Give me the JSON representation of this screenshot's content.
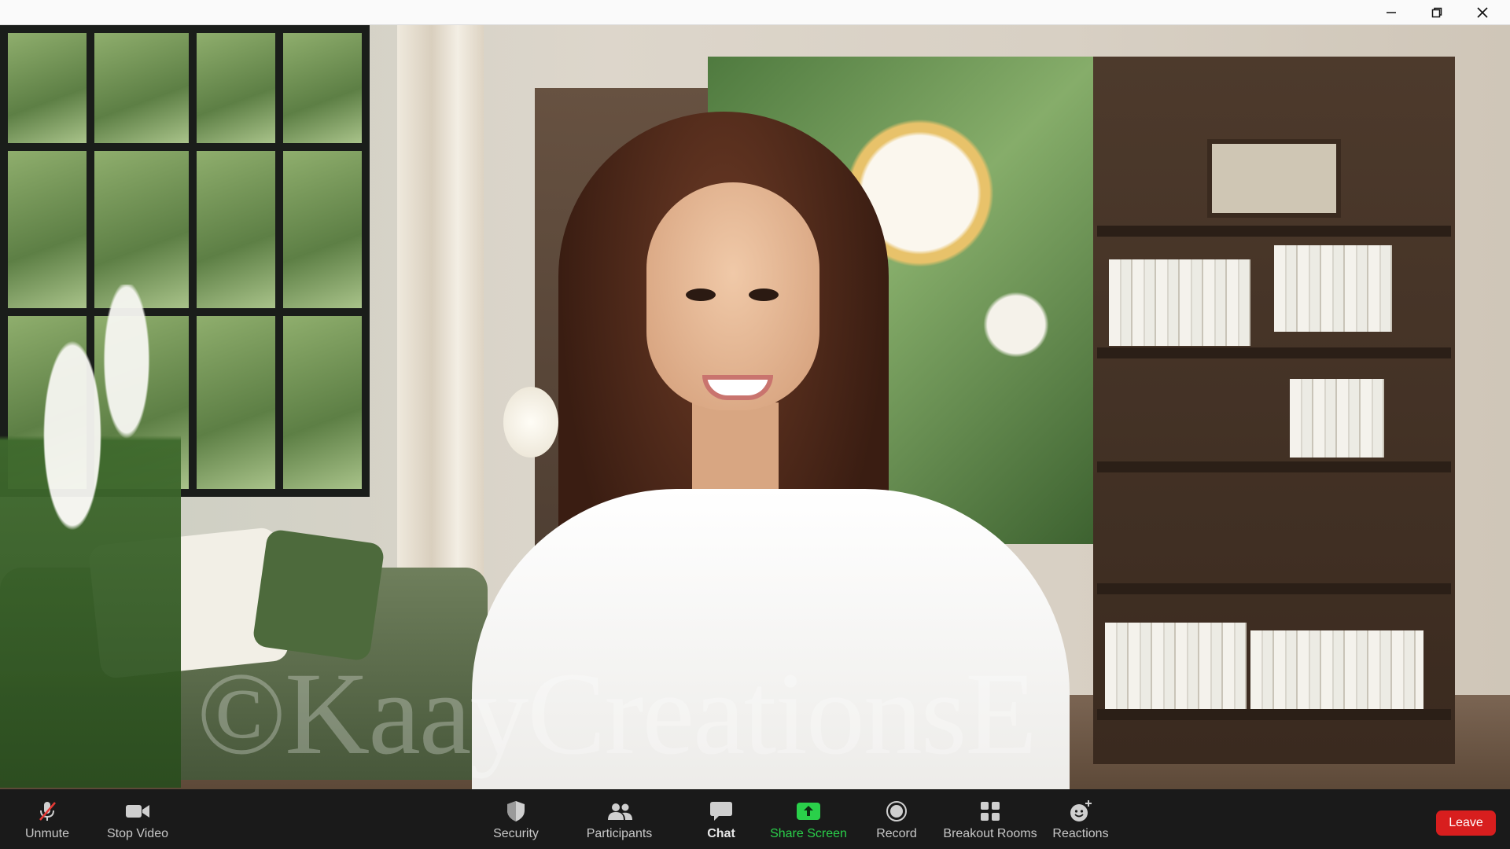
{
  "window": {
    "controls": {
      "minimize": "minimize",
      "maximize": "restore",
      "close": "close"
    }
  },
  "video": {
    "watermark": "©KaayCreationsE"
  },
  "toolbar": {
    "unmute": "Unmute",
    "stop_video": "Stop Video",
    "security": "Security",
    "participants": "Participants",
    "chat": "Chat",
    "share_screen": "Share Screen",
    "record": "Record",
    "breakout_rooms": "Breakout Rooms",
    "reactions": "Reactions",
    "leave": "Leave"
  },
  "icons": {
    "unmute": "microphone-muted-icon",
    "stop_video": "video-camera-icon",
    "security": "shield-icon",
    "participants": "people-icon",
    "chat": "chat-bubble-icon",
    "share_screen": "share-screen-arrow-icon",
    "record": "record-circle-icon",
    "breakout_rooms": "grid-icon",
    "reactions": "smiley-plus-icon"
  },
  "colors": {
    "toolbar_bg": "#1a1a1a",
    "share_green": "#2ad04a",
    "leave_red": "#d81e1e",
    "mute_red": "#e53935"
  }
}
